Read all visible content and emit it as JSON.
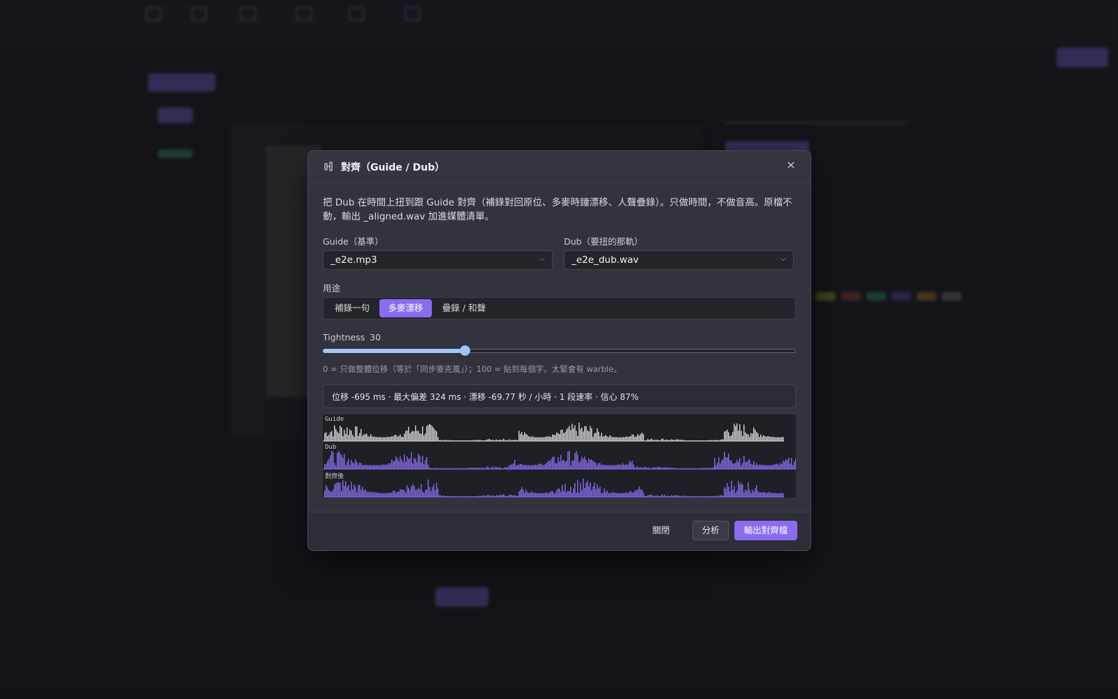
{
  "modal": {
    "title": "對齊（Guide / Dub）",
    "description": "把 Dub 在時間上扭到跟 Guide 對齊（補錄對回原位、多麥時鐘漂移、人聲疊錄）。只做時間，不做音高。原檔不動，輸出 _aligned.wav 加進媒體清單。",
    "guide_label": "Guide（基準）",
    "guide_value": "_e2e.mp3",
    "dub_label": "Dub（要扭的那軌）",
    "dub_value": "_e2e_dub.wav",
    "purpose_label": "用途",
    "purpose_options": [
      "補錄一句",
      "多麥漂移",
      "疊錄 / 和聲"
    ],
    "purpose_selected": "多麥漂移",
    "tightness_label": "Tightness",
    "tightness_value": "30",
    "tightness_fraction": 0.3,
    "hint": "0 = 只做整體位移（等於「同步麥克風」）；100 = 貼到每個字。太緊會有 warble。",
    "stats": "位移 -695 ms · 最大偏差 324 ms · 漂移 -69.77 秒 / 小時 · 1 段速率 · 信心 87%",
    "wave_labels": [
      "Guide",
      "Dub",
      "對齊後"
    ],
    "colors": {
      "accent": "#8b6cf0",
      "guide_wave": "#d9d9d9",
      "dub_wave": "#8b6cf0",
      "slider": "#9fc8f5"
    },
    "footer": {
      "close": "關閉",
      "analyze": "分析",
      "export": "輸出對齊檔"
    }
  }
}
